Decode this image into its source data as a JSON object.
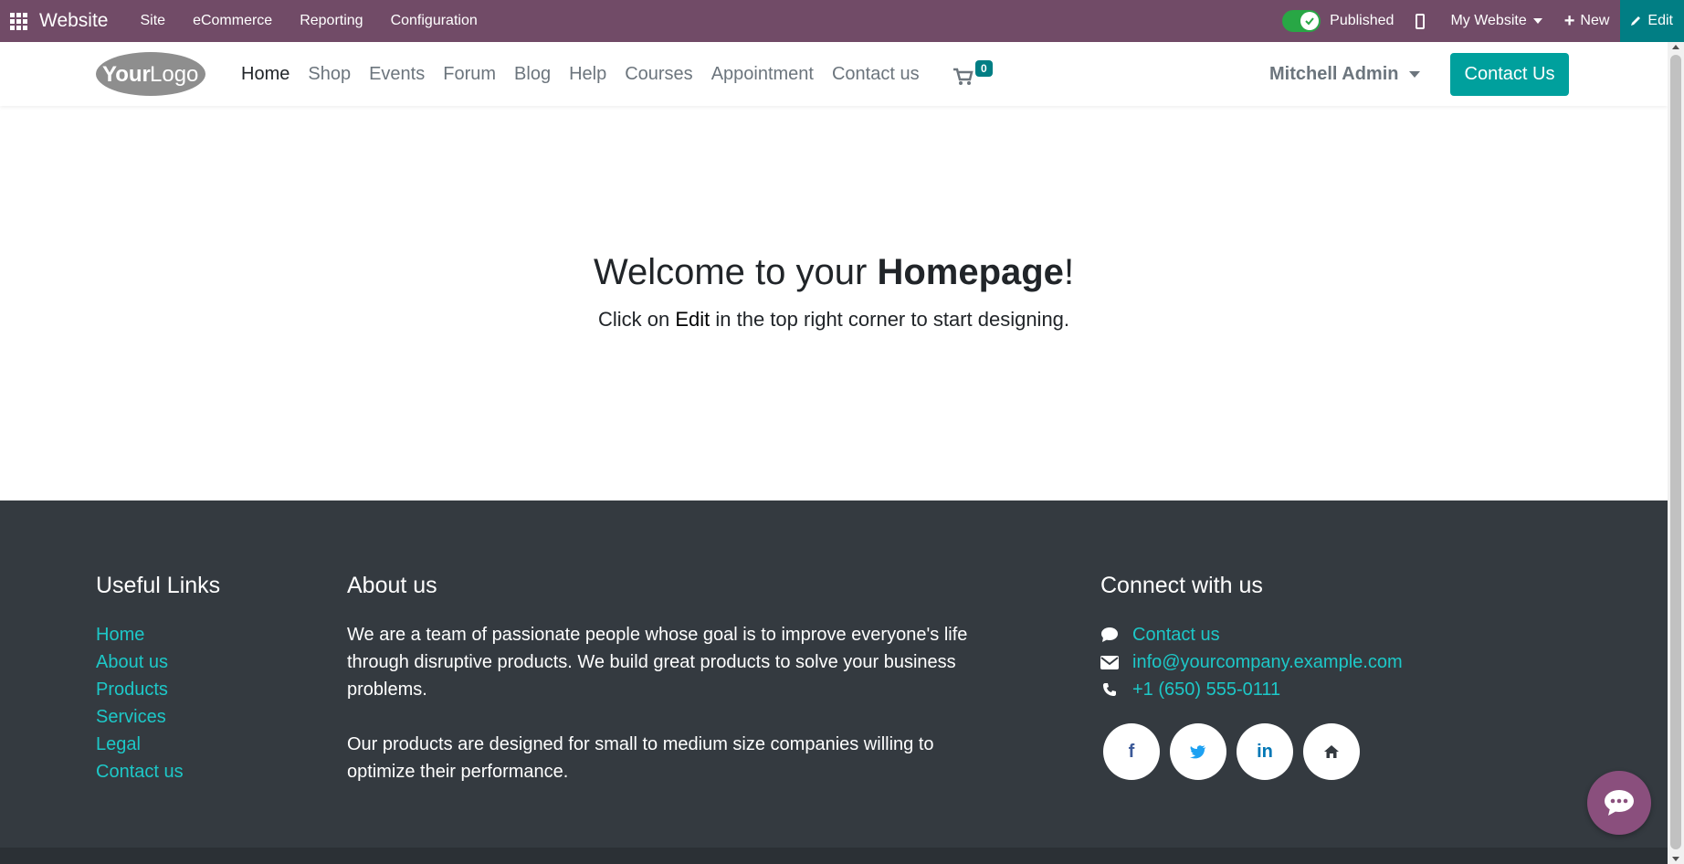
{
  "admin_bar": {
    "apps_icon": "apps-grid-icon",
    "brand": "Website",
    "menu": [
      "Site",
      "eCommerce",
      "Reporting",
      "Configuration"
    ],
    "published_label": "Published",
    "published": true,
    "mobile_icon": "mobile-phone-icon",
    "website_selector": "My Website",
    "new_label": "New",
    "edit_label": "Edit",
    "color": "#714b67",
    "edit_color": "#017e84"
  },
  "header": {
    "logo_text": {
      "your": "Your",
      "logo": "Logo"
    },
    "nav": [
      "Home",
      "Shop",
      "Events",
      "Forum",
      "Blog",
      "Help",
      "Courses",
      "Appointment",
      "Contact us"
    ],
    "active_nav": "Home",
    "cart_icon": "shopping-cart-icon",
    "cart_count": "0",
    "user_name": "Mitchell Admin",
    "cta_label": "Contact Us",
    "cta_color": "#00a09d"
  },
  "hero": {
    "title_prefix": "Welcome to your ",
    "title_bold": "Homepage",
    "title_suffix": "!",
    "subtitle_prefix": "Click on ",
    "subtitle_bold": "Edit",
    "subtitle_suffix": " in the top right corner to start designing."
  },
  "footer": {
    "useful_links": {
      "title": "Useful Links",
      "items": [
        "Home",
        "About us",
        "Products",
        "Services",
        "Legal",
        "Contact us"
      ]
    },
    "about": {
      "title": "About us",
      "paragraph1": "We are a team of passionate people whose goal is to improve everyone's life through disruptive products. We build great products to solve your business problems.",
      "paragraph2": "Our products are designed for small to medium size companies willing to optimize their performance."
    },
    "connect": {
      "title": "Connect with us",
      "contact_label": "Contact us",
      "email": "info@yourcompany.example.com",
      "phone": "+1 (650) 555-0111",
      "icons": [
        "comment-icon",
        "envelope-icon",
        "phone-icon"
      ]
    },
    "socials": [
      {
        "icon": "facebook-icon",
        "glyph": "f",
        "color": "#3b5998"
      },
      {
        "icon": "twitter-icon",
        "glyph": "t",
        "color": "#1da1f2"
      },
      {
        "icon": "linkedin-icon",
        "glyph": "in",
        "color": "#0077b5"
      },
      {
        "icon": "home-icon",
        "glyph": "⌂",
        "color": "#343a40"
      }
    ],
    "link_color": "#1dc8c8",
    "bg_color": "#343a40"
  },
  "chat": {
    "icon": "chat-bubble-icon",
    "color": "#8a4f7d"
  }
}
